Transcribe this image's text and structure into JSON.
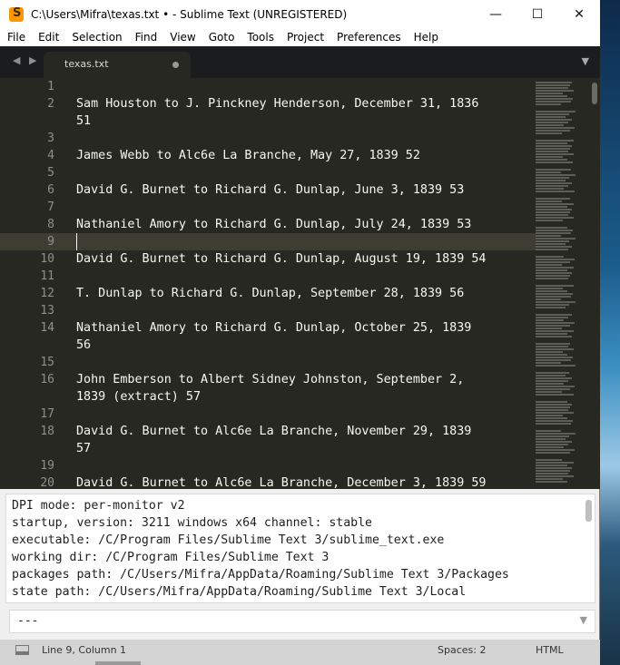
{
  "window": {
    "title": "C:\\Users\\Mifra\\texas.txt • - Sublime Text (UNREGISTERED)",
    "minimize": "—",
    "maximize": "☐",
    "close": "✕"
  },
  "menu": [
    "File",
    "Edit",
    "Selection",
    "Find",
    "View",
    "Goto",
    "Tools",
    "Project",
    "Preferences",
    "Help"
  ],
  "tabbar": {
    "nav": "◀ ▶",
    "tab_label": "texas.txt",
    "dropdown": "▼"
  },
  "editor": {
    "lines": [
      {
        "n": "1",
        "text": ""
      },
      {
        "n": "2",
        "text": "Sam Houston to J. Pinckney Henderson, December 31, 1836"
      },
      {
        "n": "",
        "text": "51"
      },
      {
        "n": "3",
        "text": ""
      },
      {
        "n": "4",
        "text": "James Webb to Alc6e La Branche, May 27, 1839 52"
      },
      {
        "n": "5",
        "text": ""
      },
      {
        "n": "6",
        "text": "David G. Burnet to Richard G. Dunlap, June 3, 1839 53"
      },
      {
        "n": "7",
        "text": ""
      },
      {
        "n": "8",
        "text": "Nathaniel Amory to Richard G. Dunlap, July 24, 1839 53"
      },
      {
        "n": "9",
        "text": ""
      },
      {
        "n": "10",
        "text": "David G. Burnet to Richard G. Dunlap, August 19, 1839 54"
      },
      {
        "n": "11",
        "text": ""
      },
      {
        "n": "12",
        "text": "T. Dunlap to Richard G. Dunlap, September 28, 1839 56"
      },
      {
        "n": "13",
        "text": ""
      },
      {
        "n": "14",
        "text": "Nathaniel Amory to Richard G. Dunlap, October 25, 1839"
      },
      {
        "n": "",
        "text": "56"
      },
      {
        "n": "15",
        "text": ""
      },
      {
        "n": "16",
        "text": "John Emberson to Albert Sidney Johnston, September 2,"
      },
      {
        "n": "",
        "text": "1839 (extract) 57"
      },
      {
        "n": "17",
        "text": ""
      },
      {
        "n": "18",
        "text": "David G. Burnet to Alc6e La Branche, November 29, 1839"
      },
      {
        "n": "",
        "text": "57"
      },
      {
        "n": "19",
        "text": ""
      },
      {
        "n": "20",
        "text": "David G. Burnet to Alc6e La Branche, December 3, 1839 59"
      }
    ]
  },
  "console": {
    "lines": [
      "DPI mode: per-monitor v2",
      "startup, version: 3211 windows x64 channel: stable",
      "executable: /C/Program Files/Sublime Text 3/sublime_text.exe",
      "working dir: /C/Program Files/Sublime Text 3",
      "packages path: /C/Users/Mifra/AppData/Roaming/Sublime Text 3/Packages",
      "state path: /C/Users/Mifra/AppData/Roaming/Sublime Text 3/Local"
    ],
    "input_value": "---"
  },
  "status": {
    "position": "Line 9, Column 1",
    "spaces": "Spaces: 2",
    "syntax": "HTML"
  }
}
